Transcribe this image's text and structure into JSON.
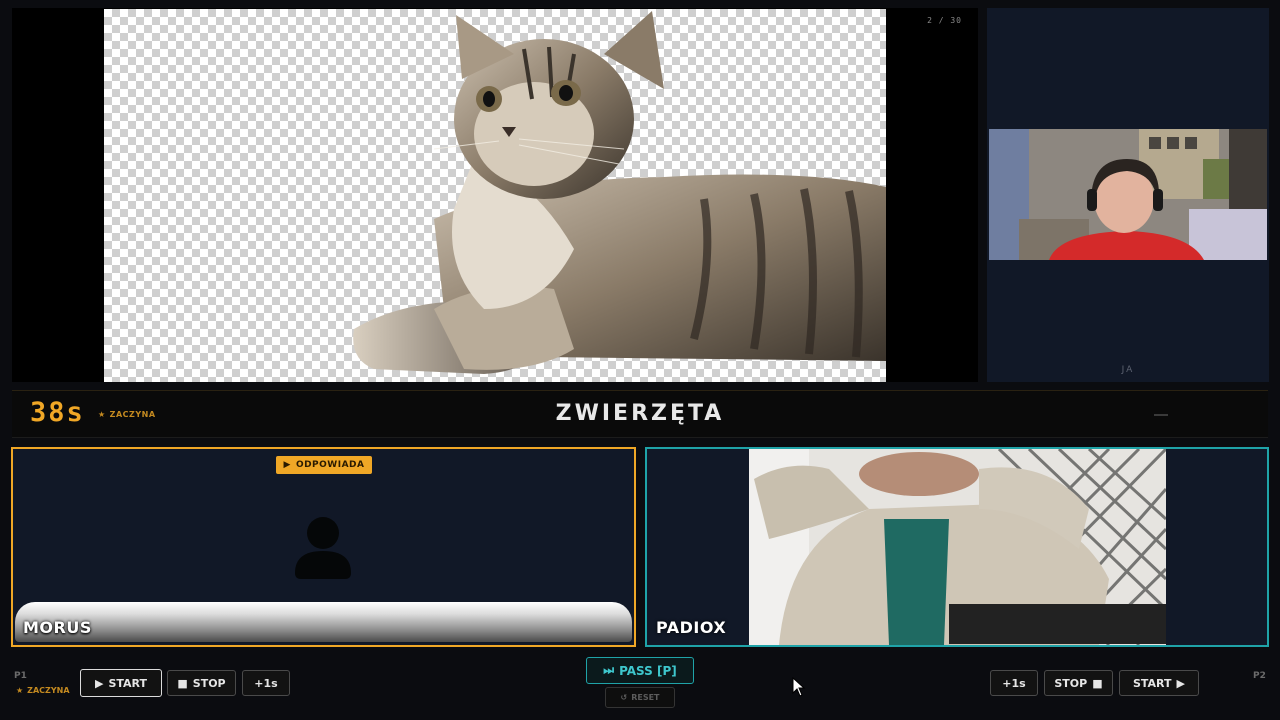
{
  "stage": {
    "counter": "2 / 30"
  },
  "self_cam": {
    "label": "JA"
  },
  "round": {
    "timer": "38s",
    "starts_label": "ZACZYNA",
    "category": "ZWIERZĘTA"
  },
  "player1": {
    "name": "MORUS",
    "status_badge": "ODPOWIADA",
    "tag": "P1",
    "starts_label": "ZACZYNA",
    "controls": {
      "start": "START",
      "stop": "STOP",
      "plus": "+1s"
    }
  },
  "player2": {
    "name": "PADIOX",
    "tag": "P2",
    "controls": {
      "plus": "+1s",
      "stop": "STOP",
      "start": "START"
    }
  },
  "center_controls": {
    "pass": "PASS [P]",
    "reset": "RESET"
  },
  "colors": {
    "accent_orange": "#f0a726",
    "accent_teal": "#1fa3a8",
    "panel_bg": "#111827",
    "page_bg": "#0b0c10"
  },
  "icons": [
    "star-icon",
    "play-icon",
    "stop-icon",
    "fast-forward-icon",
    "reset-icon",
    "person-icon",
    "cursor-icon"
  ]
}
